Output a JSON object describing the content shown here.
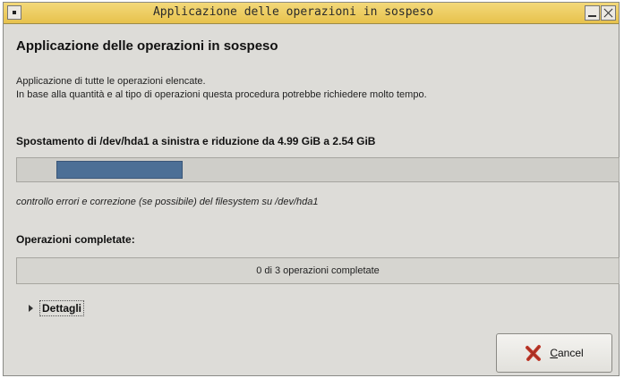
{
  "window": {
    "title": "Applicazione delle operazioni in sospeso"
  },
  "dialog": {
    "heading": "Applicazione delle operazioni in sospeso",
    "description_line1": "Applicazione di tutte le operazioni elencate.",
    "description_line2": "In base alla quantità e al tipo di operazioni questa procedura potrebbe richiedere molto tempo.",
    "current_operation": "Spostamento di /dev/hda1 a sinistra e riduzione da 4.99 GiB a 2.54 GiB",
    "current_operation_progress": 0.21,
    "current_step": "controllo errori e correzione (se possibile) del filesystem su /dev/hda1",
    "completed_label": "Operazioni completate:",
    "completed_status": "0 di 3 operazioni completate",
    "details_label": "Dettagli",
    "cancel_label": "Cancel"
  },
  "colors": {
    "titlebar": "#e9c650",
    "progress_fill": "#4c6f96",
    "window_bg": "#dddcd8",
    "cancel_icon": "#c0392b"
  },
  "icons": {
    "window_menu": "window-menu-icon",
    "minimize": "minimize-icon",
    "close": "close-icon",
    "expander": "expander-arrow-icon",
    "cancel": "cancel-x-icon"
  }
}
